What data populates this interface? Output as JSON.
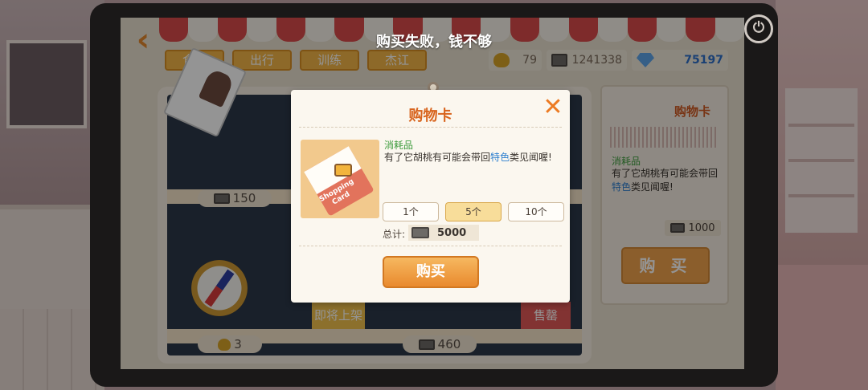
{
  "toast": "购买失败，钱不够",
  "tabs": [
    "食物",
    "出行",
    "训练",
    "杰讧"
  ],
  "currency": {
    "coins": "79",
    "bills": "1241338",
    "gems": "75197"
  },
  "shelf": {
    "prices": [
      "150",
      "3",
      "460"
    ],
    "coming_soon": "即将上架",
    "sold_out": "售罄"
  },
  "detail": {
    "title": "购物卡",
    "category": "消耗品",
    "desc_pre": "有了它胡桃有可能会带回",
    "desc_hl": "特色",
    "desc_post": "类见闻喔!",
    "price": "1000",
    "buy_label": "购 买"
  },
  "modal": {
    "title": "购物卡",
    "close": "✕",
    "category": "消耗品",
    "desc_pre": "有了它胡桃有可能会带回",
    "desc_hl": "特色",
    "desc_post": "类见闻喔!",
    "card_label": "Shopping Card",
    "quantities": [
      "1个",
      "5个",
      "10个"
    ],
    "selected_quantity": "5个",
    "total_label": "总计:",
    "total_value": "5000",
    "buy_label": "购买"
  },
  "icons": {
    "back": "back-arrow-icon",
    "power": "power-icon",
    "close": "close-icon"
  },
  "colors": {
    "accent": "#e98a2e",
    "title": "#d8641d",
    "highlight": "#2d7fcf",
    "category": "#3c9b3c"
  }
}
